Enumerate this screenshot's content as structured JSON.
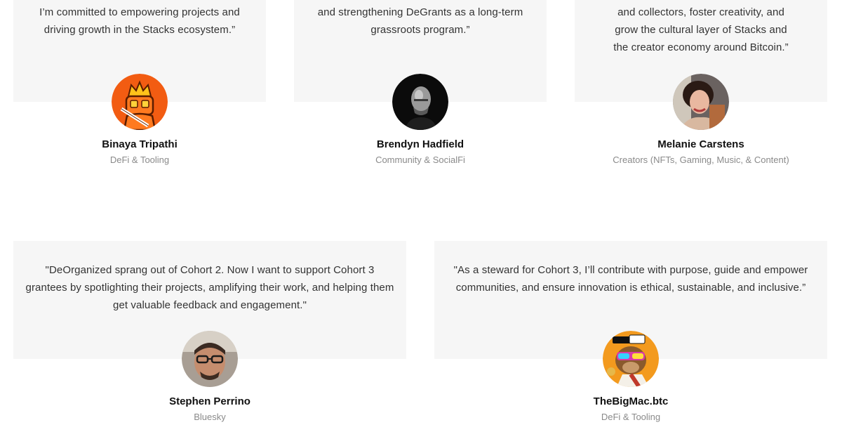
{
  "top_row": [
    {
      "quote_lines": [
        "I’m committed to empowering projects and",
        "driving growth in the Stacks ecosystem.”"
      ],
      "name": "Binaya Tripathi",
      "role": "DeFi & Tooling",
      "avatar_icon": "orange-robot-avatar"
    },
    {
      "quote_lines": [
        "and strengthening DeGrants as a long-term",
        "grassroots program.”"
      ],
      "name": "Brendyn Hadfield",
      "role": "Community & SocialFi",
      "avatar_icon": "bw-portrait-avatar"
    },
    {
      "quote_lines": [
        "and collectors, foster creativity, and",
        "grow the cultural layer of Stacks and",
        "the creator economy around Bitcoin.”"
      ],
      "name": "Melanie Carstens",
      "role": "Creators (NFTs, Gaming, Music, & Content)",
      "avatar_icon": "woman-portrait-avatar"
    }
  ],
  "bottom_row": [
    {
      "quote_lines": [
        "\"DeOrganized sprang out of Cohort 2. Now I want to support Cohort 3",
        "grantees by spotlighting their projects, amplifying their work, and helping them",
        "get valuable feedback and engagement.\""
      ],
      "name": "Stephen Perrino",
      "role": "Bluesky",
      "avatar_icon": "man-glasses-avatar"
    },
    {
      "quote_lines": [
        "\"As a steward for Cohort 3, I’ll contribute with purpose, guide and empower",
        "communities, and ensure innovation is ethical, sustainable, and inclusive.”"
      ],
      "name": "TheBigMac.btc",
      "role": "DeFi & Tooling",
      "avatar_icon": "monkey-sunglasses-avatar"
    }
  ],
  "colors": {
    "card_bg": "#f6f6f6",
    "name_text": "#111111",
    "role_text": "#8a8a8a",
    "quote_text": "#333333"
  }
}
